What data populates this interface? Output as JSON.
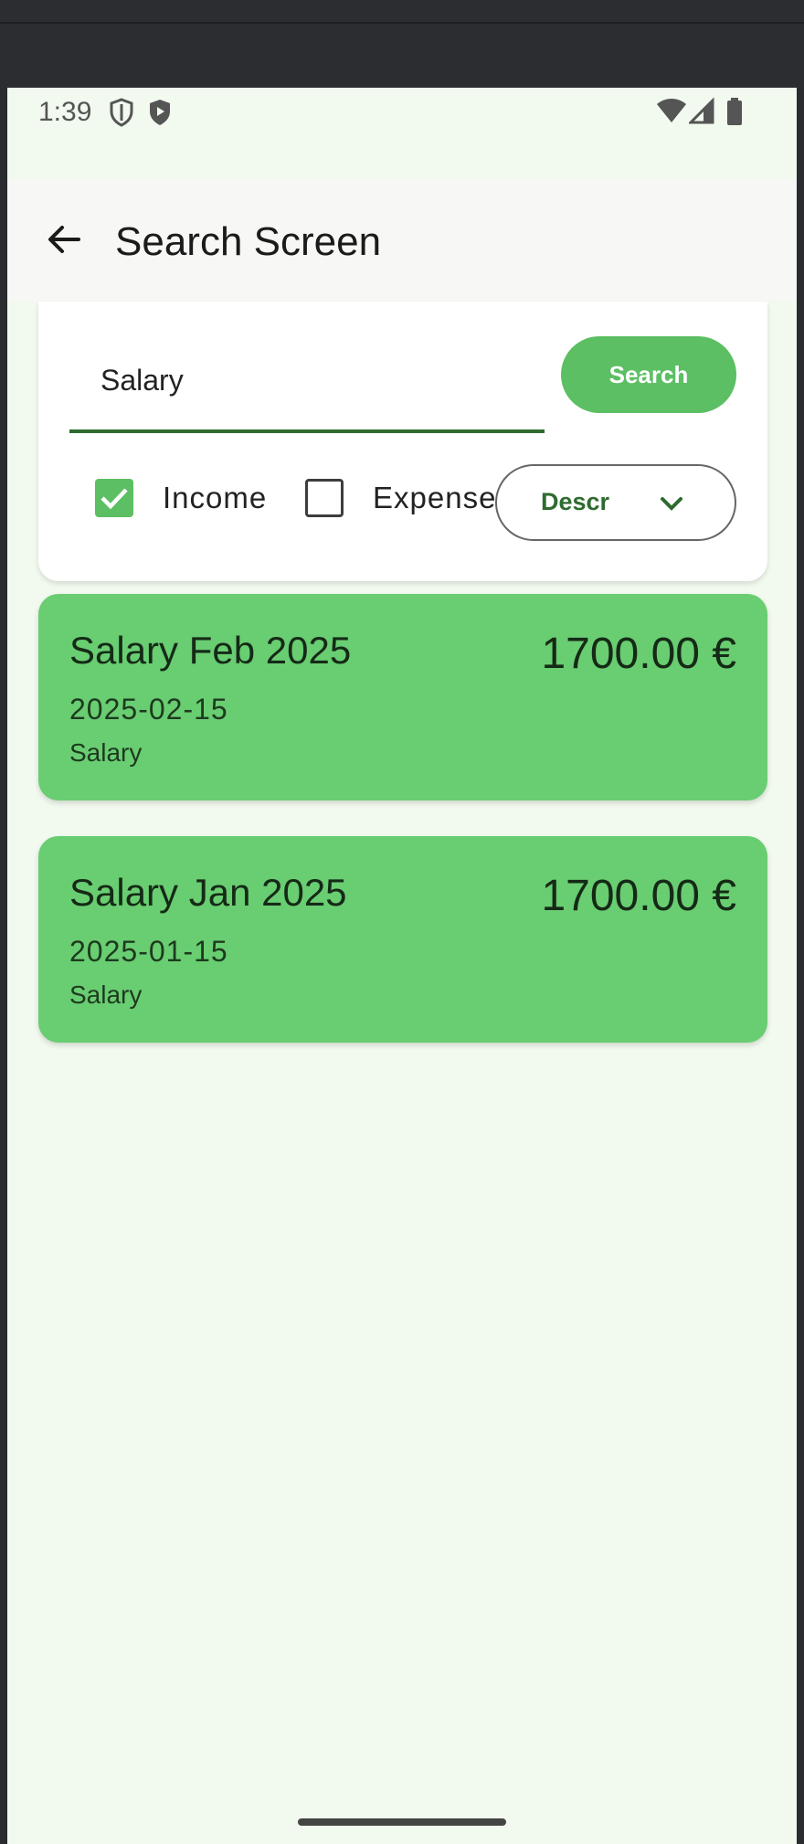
{
  "status_bar": {
    "time": "1:39"
  },
  "app_bar": {
    "title": "Search Screen",
    "back_icon": "arrow-left-icon"
  },
  "search": {
    "query": "Salary",
    "button_label": "Search"
  },
  "filters": {
    "income_label": "Income",
    "income_checked": true,
    "expense_label": "Expense",
    "expense_checked": false,
    "sort_label": "Descr"
  },
  "transactions": [
    {
      "title": "Salary Feb 2025",
      "amount": "1700.00 €",
      "date": "2025-02-15",
      "category": "Salary"
    },
    {
      "title": "Salary Jan 2025",
      "amount": "1700.00 €",
      "date": "2025-01-15",
      "category": "Salary"
    }
  ],
  "colors": {
    "accent": "#5cbf63",
    "card": "#69cd72",
    "background": "#f2faef",
    "dark_green": "#2e6b2f"
  }
}
